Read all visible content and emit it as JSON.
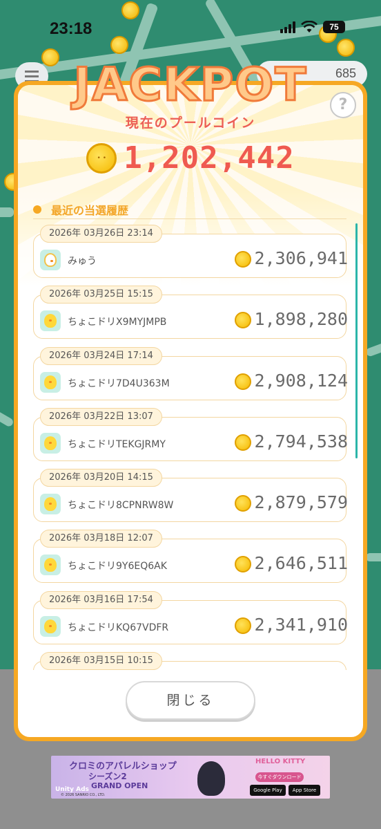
{
  "status_bar": {
    "time": "23:18",
    "battery": "75"
  },
  "app": {
    "coin_count": "685"
  },
  "jackpot": {
    "title": "JACKPOT",
    "pool_label": "現在のプールコイン",
    "pool_value": "1,202,442",
    "help_label": "?"
  },
  "history": {
    "title": "最近の当選履歴",
    "entries": [
      {
        "date": "2026年 03月26日 23:14",
        "name": "みゅう",
        "amount": "2,306,941",
        "avatar": "mew-avatar-icon"
      },
      {
        "date": "2026年 03月25日 15:15",
        "name": "ちょこドリX9MYJMPB",
        "amount": "1,898,280",
        "avatar": "chick-avatar-icon"
      },
      {
        "date": "2026年 03月24日 17:14",
        "name": "ちょこドリ7D4U363M",
        "amount": "2,908,124",
        "avatar": "chick-avatar-icon"
      },
      {
        "date": "2026年 03月22日 13:07",
        "name": "ちょこドリTEKGJRMY",
        "amount": "2,794,538",
        "avatar": "chick-avatar-icon"
      },
      {
        "date": "2026年 03月20日 14:15",
        "name": "ちょこドリ8CPNRW8W",
        "amount": "2,879,579",
        "avatar": "chick-avatar-icon"
      },
      {
        "date": "2026年 03月18日 12:07",
        "name": "ちょこドリ9Y6EQ6AK",
        "amount": "2,646,511",
        "avatar": "chick-avatar-icon"
      },
      {
        "date": "2026年 03月16日 17:54",
        "name": "ちょこドリKQ67VDFR",
        "amount": "2,341,910",
        "avatar": "chick-avatar-icon"
      },
      {
        "date": "2026年 03月15日 10:15",
        "name": "",
        "amount": "",
        "avatar": "chick-avatar-icon"
      }
    ]
  },
  "close_label": "閉じる",
  "ad": {
    "title": "クロミのアパレルショップ",
    "subtitle": "シーズン2",
    "grand_open": "GRAND OPEN",
    "unity": "Unity Ads",
    "copyright": "© 2026 SANRIO CO., LTD.",
    "brand": "HELLO KITTY",
    "cta": "今すぐダウンロード",
    "google_play": "Google Play",
    "app_store": "App Store"
  },
  "colors": {
    "accent": "#f6a823",
    "pool_value": "#ef5a50",
    "scrollbar": "#2bb5a9",
    "map": "#2f8c70"
  }
}
